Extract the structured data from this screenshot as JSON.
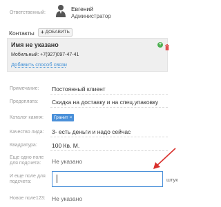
{
  "responsible": {
    "label": "Ответственный:",
    "name": "Евгений",
    "role": "Администратор"
  },
  "contacts": {
    "title": "Контакты",
    "add_button": "ДОБАВИТЬ",
    "card": {
      "name": "Имя не указано",
      "mobile": "Мобильный: +7(927)097-47-41",
      "add_link": "Добавить способ связи"
    }
  },
  "fields": [
    {
      "label": "Примечание:",
      "value": "Постоянный клиент"
    },
    {
      "label": "Предоплата:",
      "value": "Скидка на доставку и на спец.упаковку"
    },
    {
      "label": "Каталог камня:",
      "value": "Гранит"
    },
    {
      "label": "Качество лида:",
      "value": "3- есть деньги и надо сейчас"
    },
    {
      "label": "Квадратура:",
      "value": "100 Кв. М."
    },
    {
      "label": "Еще одно поле для подсчета:",
      "value": "Не указано"
    },
    {
      "label": "И еще поле для подсчета:",
      "value": "",
      "unit": "штук"
    },
    {
      "label": "Новое поле123:",
      "value": "Не указано"
    }
  ],
  "colors": {
    "accent": "#4a90d9",
    "link": "#3c8ed6",
    "arrow": "#d9302c",
    "add": "#4caf50",
    "delete": "#e05050"
  }
}
